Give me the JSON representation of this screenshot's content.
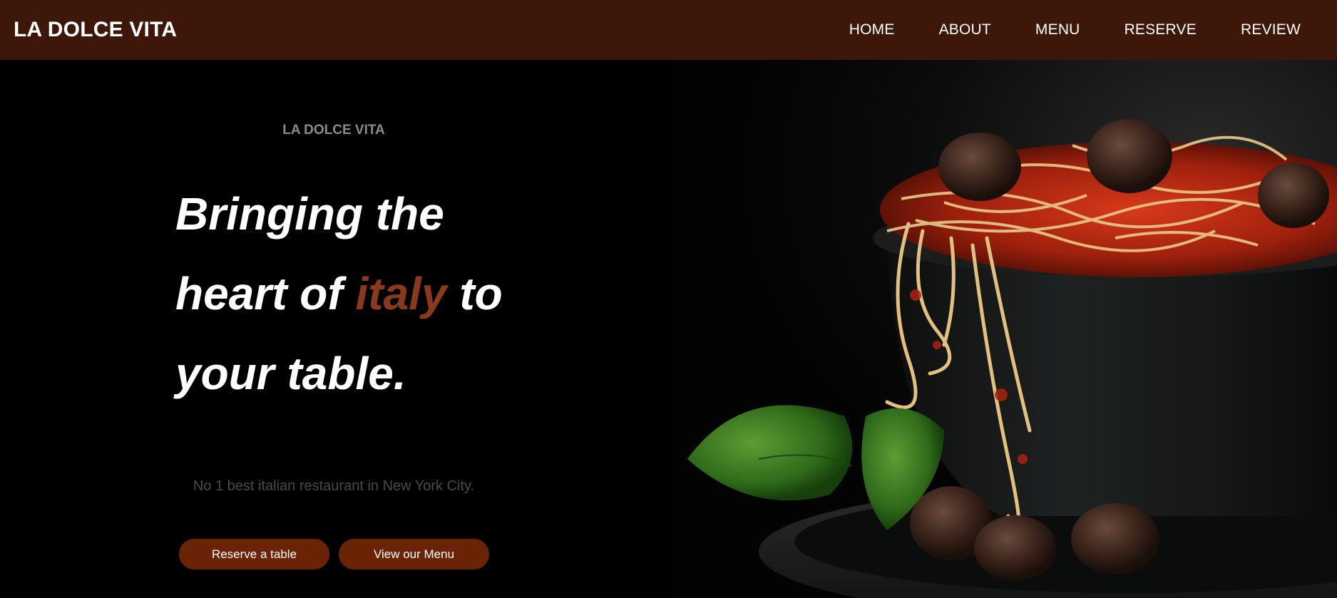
{
  "header": {
    "brand": "LA DOLCE VITA",
    "nav": [
      {
        "label": "HOME"
      },
      {
        "label": "ABOUT"
      },
      {
        "label": "MENU"
      },
      {
        "label": "RESERVE"
      },
      {
        "label": "REVIEW"
      }
    ]
  },
  "hero": {
    "eyebrow": "LA DOLCE VITA",
    "headline": {
      "line1": "Bringing the",
      "line2_pre": "heart of ",
      "line2_accent": "italy",
      "line2_post": " to",
      "line3": "your table."
    },
    "tagline": "No 1 best italian restaurant in New York City.",
    "buttons": {
      "reserve": "Reserve a table",
      "menu": "View our Menu"
    },
    "image": {
      "subject": "spaghetti-and-meatballs-photo"
    }
  },
  "colors": {
    "navbar_bg": "#3d180a",
    "accent": "#8a3a1c",
    "button_bg": "#6b2305",
    "page_bg": "#000000"
  }
}
